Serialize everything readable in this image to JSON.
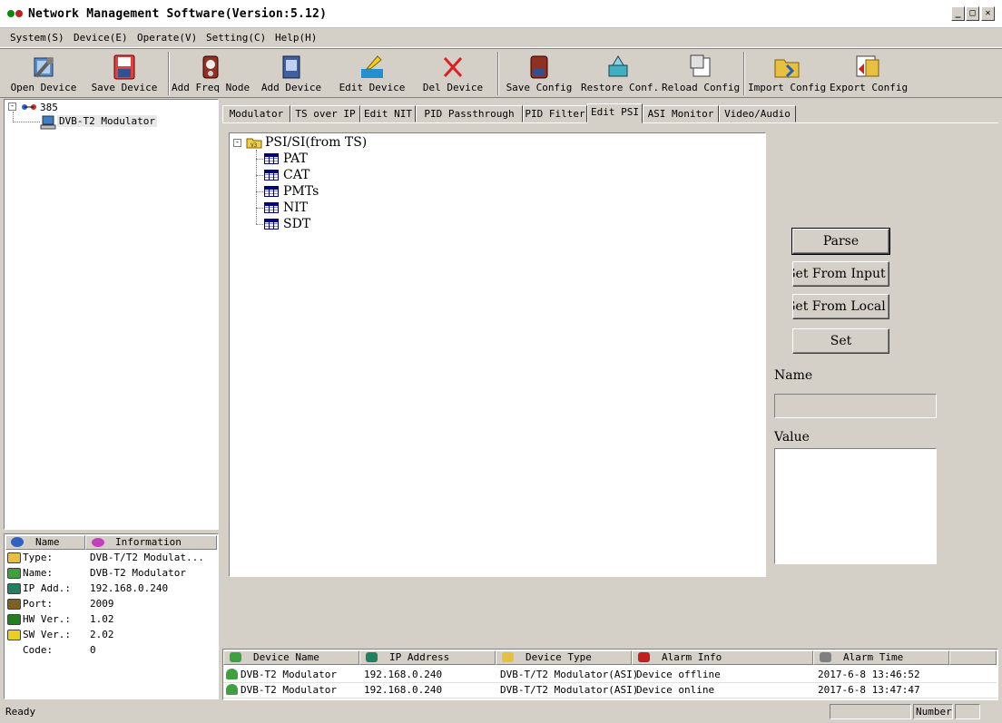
{
  "window": {
    "title": "Network Management Software(Version:5.12)"
  },
  "menu": [
    "System(S)",
    "Device(E)",
    "Operate(V)",
    "Setting(C)",
    "Help(H)"
  ],
  "toolbar": [
    {
      "label": "Open Device",
      "icon": "wrench-icon"
    },
    {
      "label": "Save Device",
      "icon": "save-icon"
    },
    {
      "label": "Add Freq Node",
      "icon": "freq-node-icon"
    },
    {
      "label": "Add Device",
      "icon": "device-icon"
    },
    {
      "label": "Edit Device",
      "icon": "edit-device-icon"
    },
    {
      "label": "Del Device",
      "icon": "delete-icon"
    },
    {
      "label": "Save Config",
      "icon": "save-config-icon"
    },
    {
      "label": "Restore Conf.",
      "icon": "restore-icon"
    },
    {
      "label": "Reload Config",
      "icon": "reload-icon"
    },
    {
      "label": "Import Config",
      "icon": "import-icon"
    },
    {
      "label": "Export Config",
      "icon": "export-icon"
    }
  ],
  "device_tree": {
    "root": "385",
    "child": "DVB-T2 Modulator"
  },
  "tabs": [
    "Modulator",
    "TS over IP",
    "Edit NIT",
    "PID Passthrough",
    "PID Filter",
    "Edit PSI",
    "ASI Monitor",
    "Video/Audio"
  ],
  "active_tab": "Edit PSI",
  "psi_tree": {
    "root": "PSI/SI(from TS)",
    "items": [
      "PAT",
      "CAT",
      "PMTs",
      "NIT",
      "SDT"
    ]
  },
  "actions": {
    "parse": "Parse",
    "get_input": "Get From Input",
    "get_local": "Get From Local",
    "set": "Set"
  },
  "fields": {
    "name_label": "Name",
    "name_value": "",
    "value_label": "Value",
    "value_value": ""
  },
  "info_panel": {
    "headers": [
      "Name",
      "Information"
    ],
    "rows": [
      {
        "name": "Type:",
        "value": "DVB-T/T2 Modulat..."
      },
      {
        "name": "Name:",
        "value": "DVB-T2 Modulator"
      },
      {
        "name": "IP Add.:",
        "value": "192.168.0.240"
      },
      {
        "name": "Port:",
        "value": "2009"
      },
      {
        "name": "HW Ver.:",
        "value": "1.02"
      },
      {
        "name": "SW Ver.:",
        "value": "2.02"
      },
      {
        "name": "Code:",
        "value": "0"
      }
    ]
  },
  "alarm_table": {
    "headers": [
      "Device Name",
      "IP Address",
      "Device Type",
      "Alarm Info",
      "Alarm Time"
    ],
    "rows": [
      [
        "DVB-T2 Modulator",
        "192.168.0.240",
        "DVB-T/T2 Modulator(ASI)",
        "Device offline",
        "2017-6-8 13:46:52"
      ],
      [
        "DVB-T2 Modulator",
        "192.168.0.240",
        "DVB-T/T2 Modulator(ASI)",
        "Device online",
        "2017-6-8 13:47:47"
      ]
    ]
  },
  "status": {
    "text": "Ready",
    "mode": "Number"
  }
}
